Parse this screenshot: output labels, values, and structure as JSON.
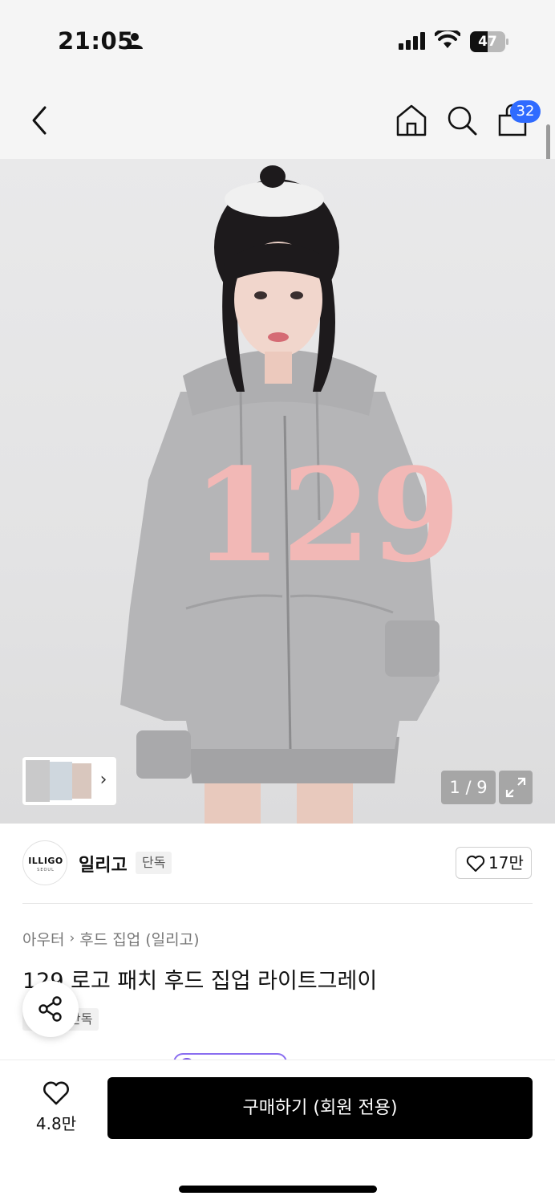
{
  "status_bar": {
    "time": "21:05",
    "battery_level": "47",
    "icons": [
      "person-icon",
      "signal-icon",
      "wifi-icon",
      "battery-icon"
    ]
  },
  "nav": {
    "icons": [
      "back-icon",
      "home-icon",
      "search-icon",
      "cart-icon"
    ],
    "cart_count": "32"
  },
  "gallery": {
    "page_counter": "1 / 9",
    "thumb_arrow": "›",
    "print_number": "129",
    "colors": {
      "hoodie": "#b5b5b7",
      "patch": "#f2b8b6",
      "background": "#e6e6e7"
    }
  },
  "brand": {
    "logo_text": "ILLIGO",
    "logo_subtext": "SEOUL",
    "name": "일리고",
    "tag": "단독",
    "likes": "17만"
  },
  "product": {
    "breadcrumb": [
      "아우터",
      "후드 집업 (일리고)"
    ],
    "breadcrumb_separator": "›",
    "title": "129 로고 패치 후드 집업 라이트그레이",
    "exclusive_tag": "단독"
  },
  "bottom_bar": {
    "wish_count": "4.8만",
    "buy_label": "구매하기 (회원 전용)"
  },
  "colors": {
    "accent_blue": "#2f6bff",
    "buy_button": "#000000",
    "chip_purple": "#8a6ef0"
  }
}
